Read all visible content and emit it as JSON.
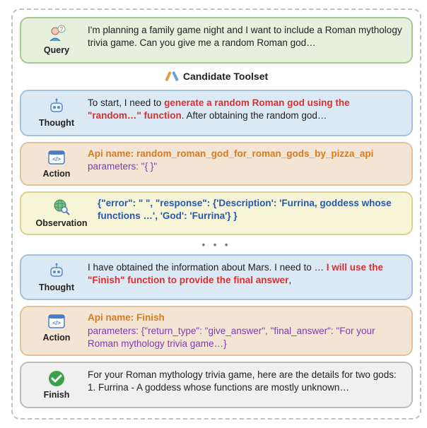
{
  "labels": {
    "query": "Query",
    "thought": "Thought",
    "action": "Action",
    "observation": "Observation",
    "finish": "Finish",
    "toolset": "Candidate Toolset"
  },
  "query": {
    "text": "I'm planning a family game night and I want to include a Roman mythology trivia game. Can you give me a random Roman god…"
  },
  "thought1": {
    "plain1": "To start, I need to ",
    "red1": "generate a random Roman god using the \"random…\" function",
    "plain2": ". After obtaining the random god…"
  },
  "action1": {
    "api_label": "Api name: ",
    "api_value": "random_roman_god_for_roman_gods_by_pizza_api",
    "params_label": "parameters:  ",
    "params_value": "\"{ }\""
  },
  "observation": {
    "text": "{\"error\": \" \", \"response\": {'Description': 'Furrina, goddess whose functions …', 'God': 'Furrina'} }"
  },
  "thought2": {
    "plain1": "I have obtained the information about Mars. I need to … ",
    "red1": "I will use the \"Finish\" function to provide the final answer",
    "plain2": ","
  },
  "action2": {
    "api_label": "Api name: ",
    "api_value": "Finish",
    "params_label": "parameters: ",
    "params_value": "{\"return_type\": \"give_answer\", \"final_answer\": \"For your Roman mythology trivia game…}"
  },
  "finish": {
    "text": "For your Roman mythology trivia game, here are the details for two gods: 1. Furrina - A goddess whose functions are mostly unknown…"
  },
  "ellipsis": "•  •  •"
}
